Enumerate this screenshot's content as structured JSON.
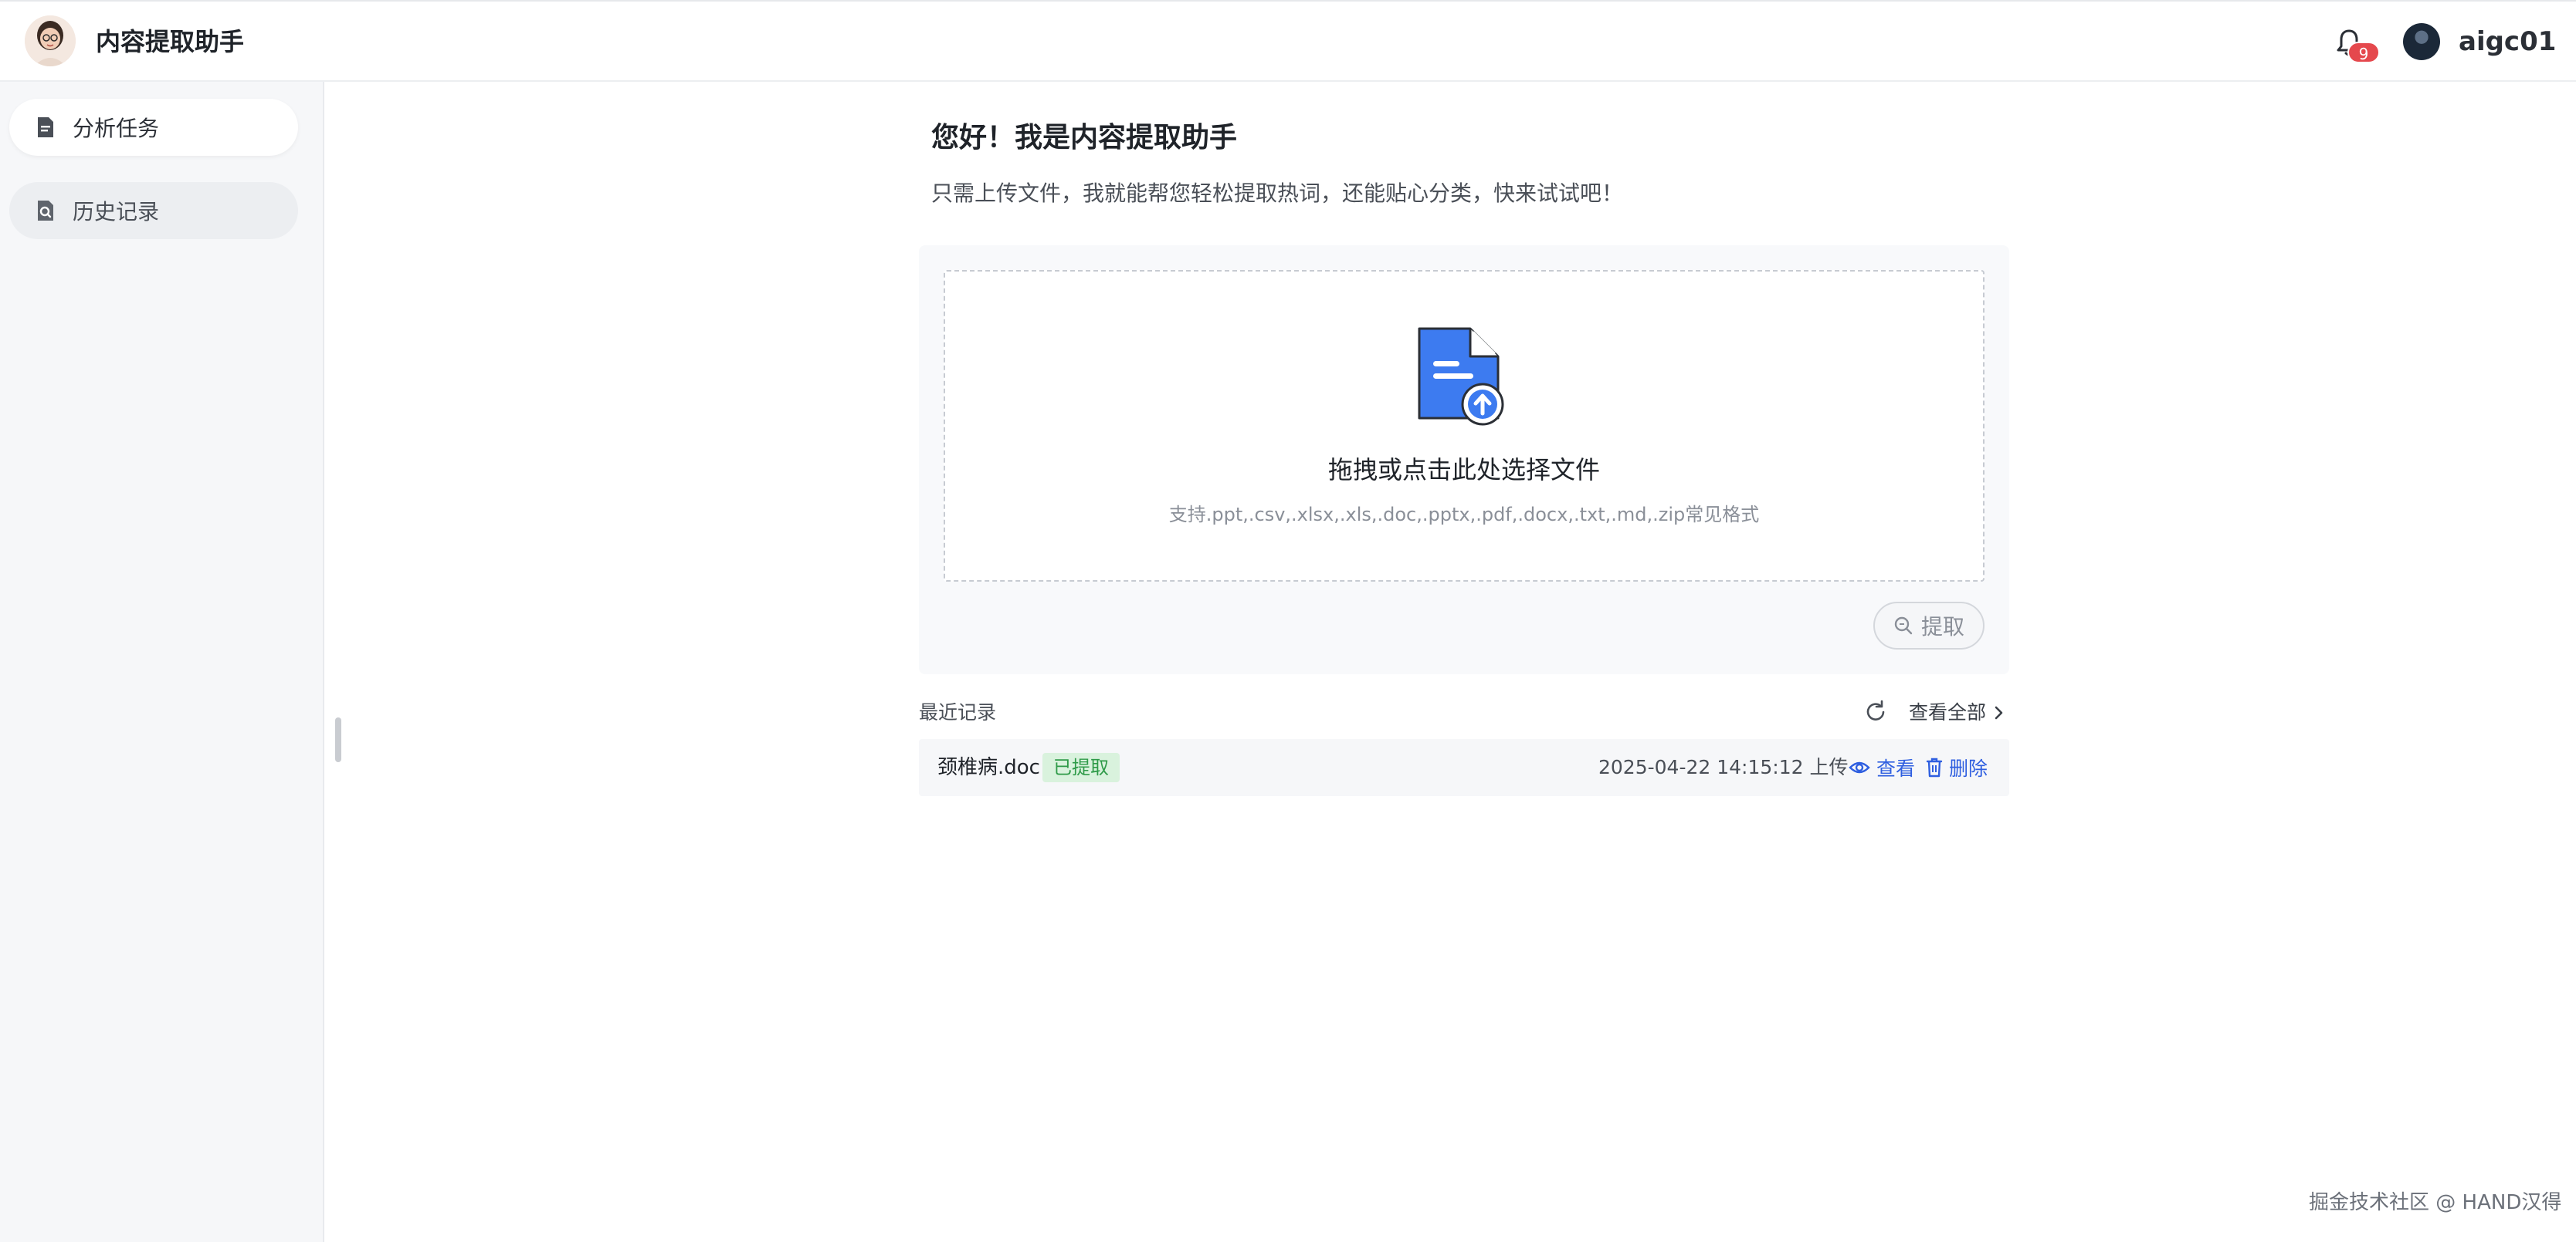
{
  "header": {
    "app_title": "内容提取助手",
    "notification_count": "9",
    "username": "aigc01"
  },
  "sidebar": {
    "items": [
      {
        "label": "分析任务",
        "icon": "document-icon",
        "active": true
      },
      {
        "label": "历史记录",
        "icon": "history-search-icon",
        "active": false
      }
    ]
  },
  "main": {
    "greeting": "您好！我是内容提取助手",
    "subtitle": "只需上传文件，我就能帮您轻松提取热词，还能贴心分类，快来试试吧！",
    "upload": {
      "title": "拖拽或点击此处选择文件",
      "hint": "支持.ppt,.csv,.xlsx,.xls,.doc,.pptx,.pdf,.docx,.txt,.md,.zip常见格式",
      "extract_label": "提取"
    },
    "recent": {
      "title": "最近记录",
      "view_all_label": "查看全部",
      "records": [
        {
          "file_name": "颈椎病.doc",
          "status": "已提取",
          "uploaded_at": "2025-04-22 14:15:12 上传",
          "view_label": "查看",
          "delete_label": "删除"
        }
      ]
    }
  },
  "footer": {
    "watermark": "掘金技术社区 @ HAND汉得"
  },
  "colors": {
    "accent": "#2f5fe0",
    "badge": "#e5484d",
    "status_success_bg": "#d9f2dd",
    "status_success_text": "#2e9a48",
    "file_icon_blue": "#3d7bf0"
  }
}
